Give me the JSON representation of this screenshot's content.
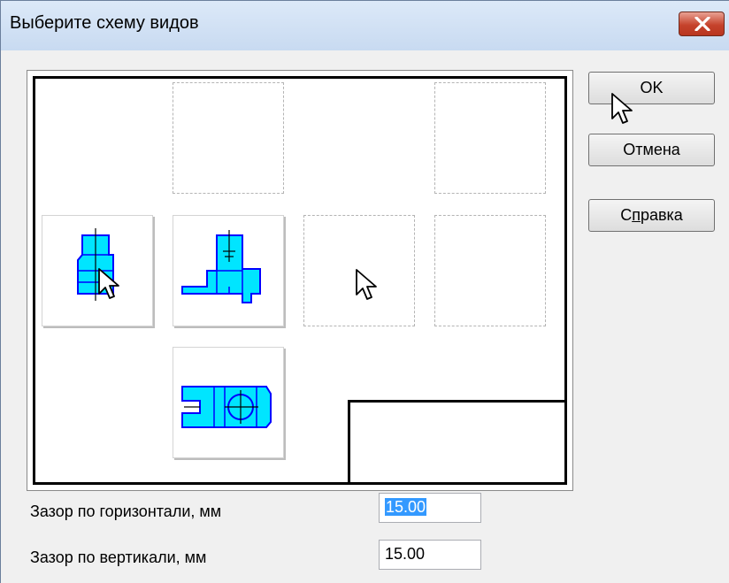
{
  "window": {
    "title": "Выберите схему видов",
    "close_icon": "close-icon"
  },
  "buttons": {
    "ok": "OK",
    "cancel": "Отмена",
    "help_prefix": "С",
    "help_mnemonic": "п",
    "help_rest": "равка"
  },
  "views": {
    "slots": [
      {
        "id": "top-middle",
        "state": "empty"
      },
      {
        "id": "top-right",
        "state": "empty"
      },
      {
        "id": "left",
        "state": "filled",
        "icon": "side-view-drawing-icon"
      },
      {
        "id": "front",
        "state": "filled",
        "icon": "front-view-drawing-icon"
      },
      {
        "id": "right",
        "state": "empty"
      },
      {
        "id": "far-right",
        "state": "empty"
      },
      {
        "id": "bottom",
        "state": "filled",
        "icon": "top-view-drawing-icon"
      }
    ],
    "fill_color": "#00e5ff",
    "line_color": "#0000ff"
  },
  "fields": {
    "horizontal_gap": {
      "label": "Зазор по горизонтали, мм",
      "value": "15.00",
      "selected": true
    },
    "vertical_gap": {
      "label": "Зазор по вертикали, мм",
      "value": "15.00",
      "selected": false
    }
  }
}
